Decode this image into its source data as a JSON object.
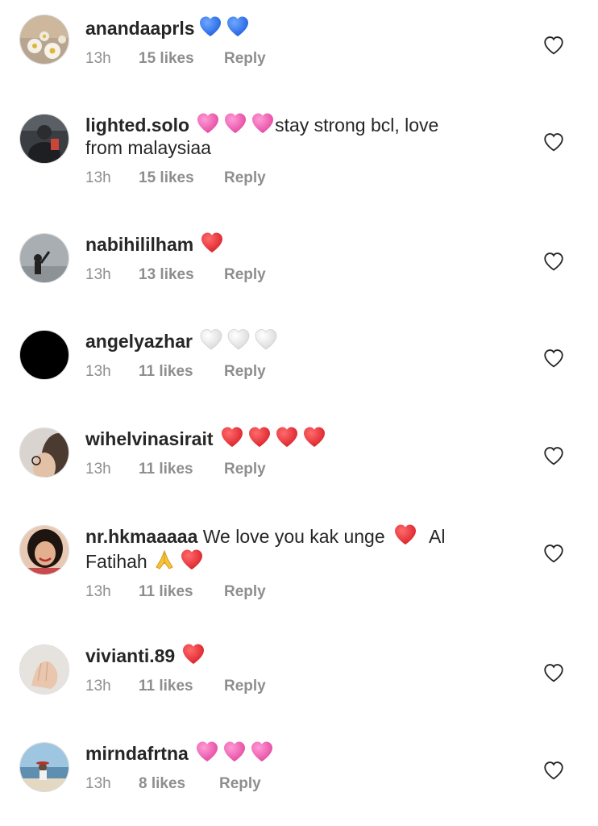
{
  "comments": [
    {
      "username": "anandaaprls",
      "text": "",
      "emojis": [
        "blue-heart",
        "blue-heart"
      ],
      "time": "13h",
      "likes": "15 likes",
      "reply": "Reply",
      "avatar": "avatar-daisies"
    },
    {
      "username": "lighted.solo",
      "text_before_emojis": "",
      "emojis": [
        "pink-heart",
        "pink-heart",
        "pink-heart"
      ],
      "text": "stay strong bcl, love",
      "text_line2": "from malaysiaa",
      "time": "13h",
      "likes": "15 likes",
      "reply": "Reply",
      "avatar": "avatar-dark-figure"
    },
    {
      "username": "nabihililham",
      "text": "",
      "emojis": [
        "red-heart"
      ],
      "time": "13h",
      "likes": "13 likes",
      "reply": "Reply",
      "avatar": "avatar-silhouette"
    },
    {
      "username": "angelyazhar",
      "text": "",
      "emojis": [
        "white-heart",
        "white-heart",
        "white-heart"
      ],
      "time": "13h",
      "likes": "11 likes",
      "reply": "Reply",
      "avatar": "avatar-black"
    },
    {
      "username": "wihelvinasirait",
      "text": "",
      "emojis": [
        "red-heart",
        "red-heart",
        "red-heart",
        "red-heart"
      ],
      "time": "13h",
      "likes": "11 likes",
      "reply": "Reply",
      "avatar": "avatar-person-glasses"
    },
    {
      "username": "nr.hkmaaaaa",
      "text": "We love you kak unge",
      "emojis": [
        "red-heart"
      ],
      "text_after": "Al",
      "text_line2": "Fatihah",
      "emojis_line2": [
        "folded-hands",
        "red-heart"
      ],
      "time": "13h",
      "likes": "11 likes",
      "reply": "Reply",
      "avatar": "avatar-smiling-woman"
    },
    {
      "username": "vivianti.89",
      "text": "",
      "emojis": [
        "red-heart"
      ],
      "time": "13h",
      "likes": "11 likes",
      "reply": "Reply",
      "avatar": "avatar-hand"
    },
    {
      "username": "mirndafrtna",
      "text": "",
      "emojis": [
        "pink-heart",
        "pink-heart",
        "pink-heart"
      ],
      "time": "13h",
      "likes": "8 likes",
      "reply": "Reply",
      "avatar": "avatar-beach"
    }
  ],
  "colors": {
    "text": "#262626",
    "meta": "#8e8e8e",
    "red_heart": "#e8313a",
    "blue_heart": "#2f6fe8",
    "pink_heart": "#f06bb8",
    "white_heart": "#eeeeee"
  }
}
